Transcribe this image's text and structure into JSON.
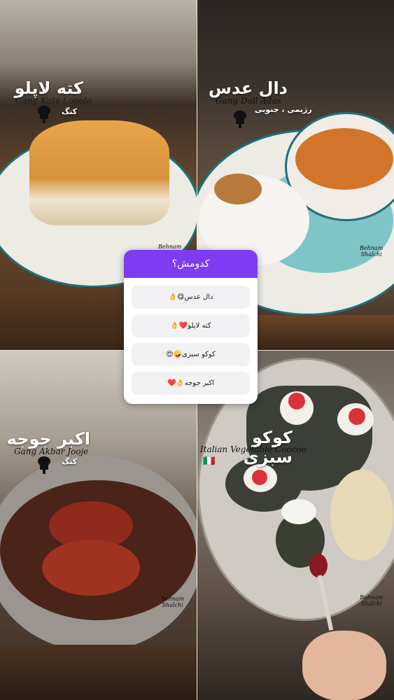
{
  "dishes": {
    "top_left": {
      "title": "کته لاپلو",
      "subtitle": "Gang Kate Lopolo",
      "note": "کنگ"
    },
    "top_right": {
      "title": "دال عدس",
      "subtitle": "Gang Dall Adas",
      "note": "رژیمی ، جنوبی"
    },
    "bottom_left": {
      "title": "اکبر جوجه",
      "subtitle": "Gang Akbar Jooje",
      "note": "کنگ"
    },
    "bottom_right": {
      "title": "کوکو سبزی",
      "subtitle": "Italian Vegetable Coocoo",
      "flag": "🇮🇹"
    }
  },
  "watermark": {
    "line1": "Behnam",
    "line2": "Shalchi"
  },
  "poll": {
    "question": "کدومش؟",
    "options": [
      {
        "label": "دال عدس😋👌"
      },
      {
        "label": "کته لاپلو❤️👌"
      },
      {
        "label": "کوکو سبزی🤪😍"
      },
      {
        "label": "اکبر جوجه👌❤️"
      }
    ]
  },
  "colors": {
    "poll_accent": "#7d3bf2",
    "plate_rim": "#1f6f7a"
  }
}
